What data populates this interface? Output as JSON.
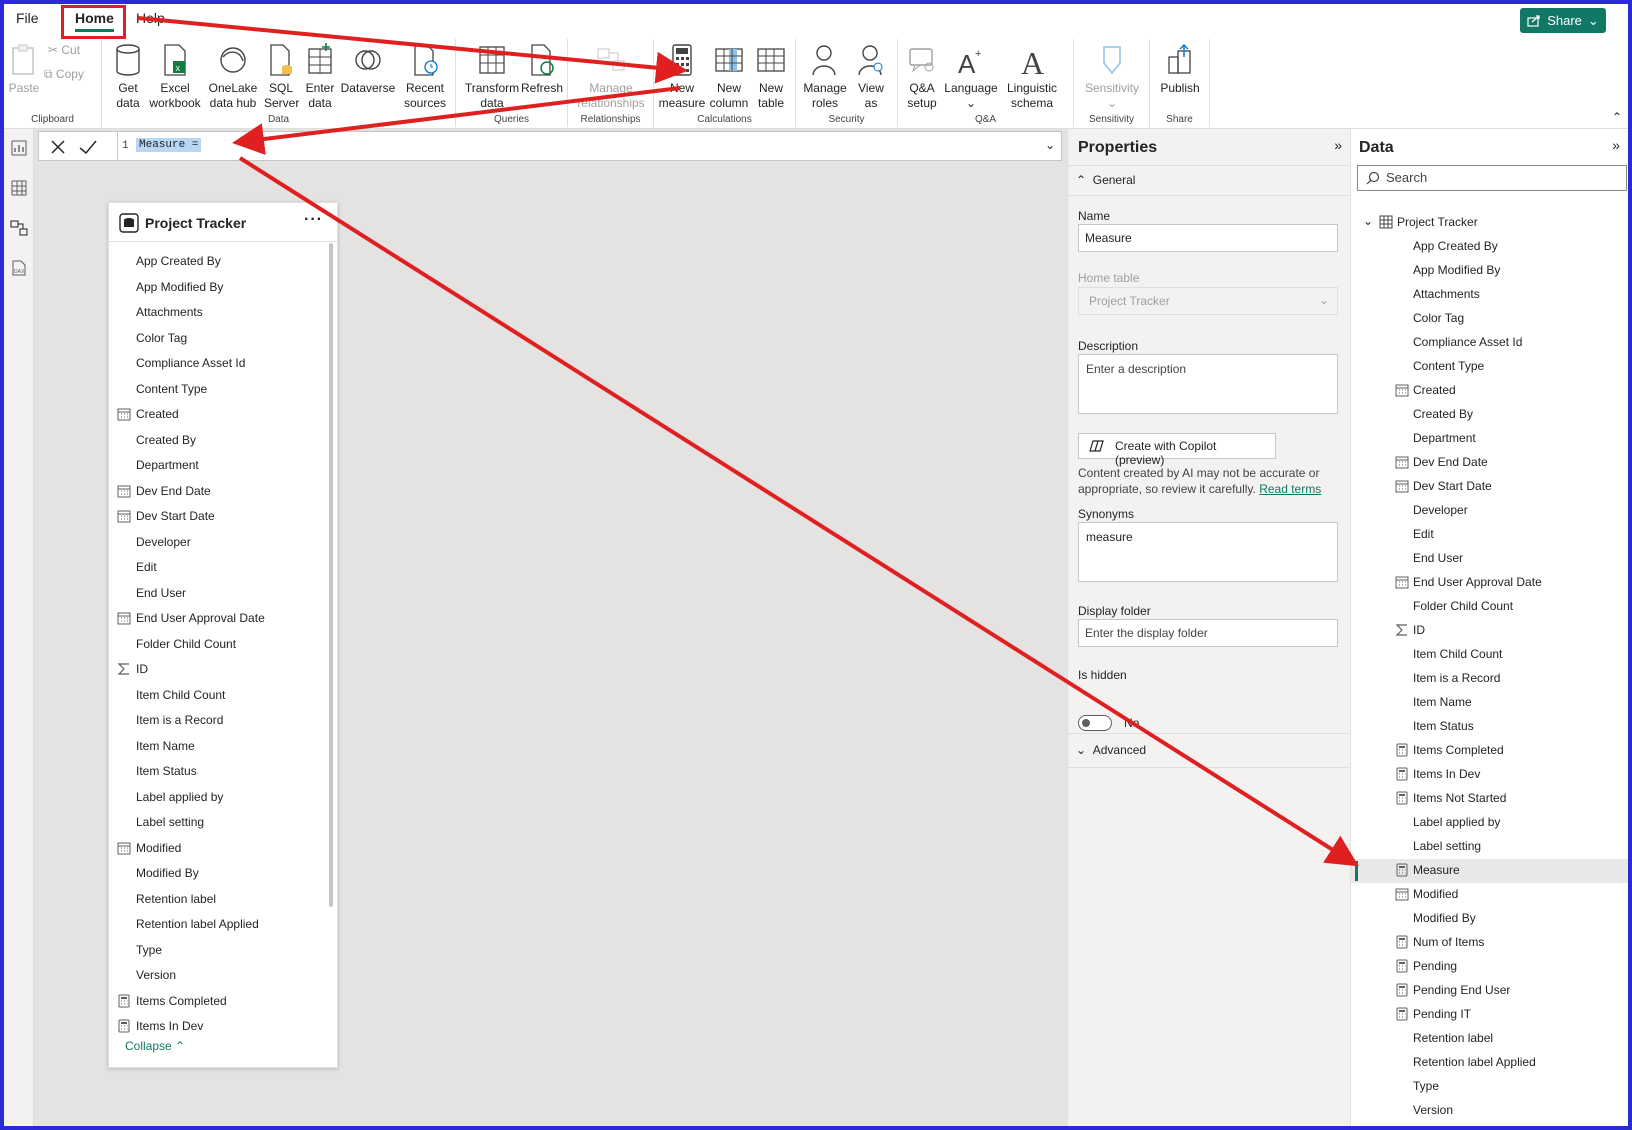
{
  "menubar": {
    "file": "File",
    "home": "Home",
    "help": "Help",
    "share": "Share"
  },
  "ribbon": {
    "clipboard": {
      "paste": "Paste",
      "cut": "Cut",
      "copy": "Copy",
      "label": "Clipboard"
    },
    "data": {
      "get_data": "Get\ndata",
      "excel": "Excel\nworkbook",
      "onelake": "OneLake\ndata hub",
      "sql": "SQL\nServer",
      "enter_data": "Enter\ndata",
      "dataverse": "Dataverse",
      "recent": "Recent\nsources",
      "label": "Data"
    },
    "queries": {
      "transform": "Transform\ndata",
      "refresh": "Refresh",
      "label": "Queries"
    },
    "relationships": {
      "manage": "Manage\nrelationships",
      "label": "Relationships"
    },
    "calculations": {
      "new_measure": "New\nmeasure",
      "new_column": "New\ncolumn",
      "new_table": "New\ntable",
      "label": "Calculations"
    },
    "security": {
      "manage_roles": "Manage\nroles",
      "view_as": "View\nas",
      "label": "Security"
    },
    "qa": {
      "qa_setup": "Q&A\nsetup",
      "language": "Language",
      "linguistic": "Linguistic\nschema",
      "label": "Q&A"
    },
    "sensitivity": {
      "sensitivity": "Sensitivity",
      "label": "Sensitivity"
    },
    "share": {
      "publish": "Publish",
      "label": "Share"
    }
  },
  "formula": {
    "line_number": "1",
    "code": "Measure ="
  },
  "card": {
    "title": "Project Tracker",
    "more": "···",
    "collapse": "Collapse",
    "fields": [
      {
        "label": "App Created By",
        "icon": ""
      },
      {
        "label": "App Modified By",
        "icon": ""
      },
      {
        "label": "Attachments",
        "icon": ""
      },
      {
        "label": "Color Tag",
        "icon": ""
      },
      {
        "label": "Compliance Asset Id",
        "icon": ""
      },
      {
        "label": "Content Type",
        "icon": ""
      },
      {
        "label": "Created",
        "icon": "calendar"
      },
      {
        "label": "Created By",
        "icon": ""
      },
      {
        "label": "Department",
        "icon": ""
      },
      {
        "label": "Dev End Date",
        "icon": "calendar"
      },
      {
        "label": "Dev Start Date",
        "icon": "calendar"
      },
      {
        "label": "Developer",
        "icon": ""
      },
      {
        "label": "Edit",
        "icon": ""
      },
      {
        "label": "End User",
        "icon": ""
      },
      {
        "label": "End User Approval Date",
        "icon": "calendar"
      },
      {
        "label": "Folder Child Count",
        "icon": ""
      },
      {
        "label": "ID",
        "icon": "sigma"
      },
      {
        "label": "Item Child Count",
        "icon": ""
      },
      {
        "label": "Item is a Record",
        "icon": ""
      },
      {
        "label": "Item Name",
        "icon": ""
      },
      {
        "label": "Item Status",
        "icon": ""
      },
      {
        "label": "Label applied by",
        "icon": ""
      },
      {
        "label": "Label setting",
        "icon": ""
      },
      {
        "label": "Modified",
        "icon": "calendar"
      },
      {
        "label": "Modified By",
        "icon": ""
      },
      {
        "label": "Retention label",
        "icon": ""
      },
      {
        "label": "Retention label Applied",
        "icon": ""
      },
      {
        "label": "Type",
        "icon": ""
      },
      {
        "label": "Version",
        "icon": ""
      },
      {
        "label": "Items Completed",
        "icon": "calculator"
      },
      {
        "label": "Items In Dev",
        "icon": "calculator"
      }
    ]
  },
  "properties": {
    "title": "Properties",
    "general": "General",
    "name_label": "Name",
    "name_value": "Measure",
    "home_table_label": "Home table",
    "home_table_value": "Project Tracker",
    "description_label": "Description",
    "description_placeholder": "Enter a description",
    "copilot_button": "Create with Copilot (preview)",
    "ai_note": "Content created by AI may not be accurate or appropriate, so review it carefully.",
    "read_terms": "Read terms",
    "synonyms_label": "Synonyms",
    "synonyms_value": "measure",
    "display_folder_label": "Display folder",
    "display_folder_placeholder": "Enter the display folder",
    "is_hidden_label": "Is hidden",
    "is_hidden_value": "No",
    "advanced": "Advanced"
  },
  "data_pane": {
    "title": "Data",
    "search_placeholder": "Search",
    "table": "Project Tracker",
    "fields": [
      {
        "label": "App Created By",
        "icon": ""
      },
      {
        "label": "App Modified By",
        "icon": ""
      },
      {
        "label": "Attachments",
        "icon": ""
      },
      {
        "label": "Color Tag",
        "icon": ""
      },
      {
        "label": "Compliance Asset Id",
        "icon": ""
      },
      {
        "label": "Content Type",
        "icon": ""
      },
      {
        "label": "Created",
        "icon": "calendar"
      },
      {
        "label": "Created By",
        "icon": ""
      },
      {
        "label": "Department",
        "icon": ""
      },
      {
        "label": "Dev End Date",
        "icon": "calendar"
      },
      {
        "label": "Dev Start Date",
        "icon": "calendar"
      },
      {
        "label": "Developer",
        "icon": ""
      },
      {
        "label": "Edit",
        "icon": ""
      },
      {
        "label": "End User",
        "icon": ""
      },
      {
        "label": "End User Approval Date",
        "icon": "calendar"
      },
      {
        "label": "Folder Child Count",
        "icon": ""
      },
      {
        "label": "ID",
        "icon": "sigma"
      },
      {
        "label": "Item Child Count",
        "icon": ""
      },
      {
        "label": "Item is a Record",
        "icon": ""
      },
      {
        "label": "Item Name",
        "icon": ""
      },
      {
        "label": "Item Status",
        "icon": ""
      },
      {
        "label": "Items Completed",
        "icon": "calculator"
      },
      {
        "label": "Items In Dev",
        "icon": "calculator"
      },
      {
        "label": "Items Not Started",
        "icon": "calculator"
      },
      {
        "label": "Label applied by",
        "icon": ""
      },
      {
        "label": "Label setting",
        "icon": ""
      },
      {
        "label": "Measure",
        "icon": "calculator",
        "selected": true
      },
      {
        "label": "Modified",
        "icon": "calendar"
      },
      {
        "label": "Modified By",
        "icon": ""
      },
      {
        "label": "Num of Items",
        "icon": "calculator"
      },
      {
        "label": "Pending",
        "icon": "calculator"
      },
      {
        "label": "Pending End User",
        "icon": "calculator"
      },
      {
        "label": "Pending IT",
        "icon": "calculator"
      },
      {
        "label": "Retention label",
        "icon": ""
      },
      {
        "label": "Retention label Applied",
        "icon": ""
      },
      {
        "label": "Type",
        "icon": ""
      },
      {
        "label": "Version",
        "icon": ""
      }
    ]
  },
  "colors": {
    "accent": "#117865",
    "annotation": "#e02020",
    "frame": "#2b2bd6"
  }
}
